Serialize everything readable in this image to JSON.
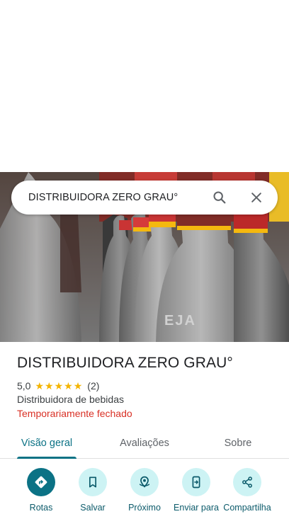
{
  "search": {
    "query": "DISTRIBUIDORA ZERO GRAU°"
  },
  "place": {
    "name": "DISTRIBUIDORA ZERO GRAU°",
    "rating": "5,0",
    "stars": 5,
    "reviews_count": "(2)",
    "category": "Distribuidora de bebidas",
    "status": "Temporariamente fechado"
  },
  "photo": {
    "label_text": "EJA"
  },
  "tabs": [
    {
      "label": "Visão geral",
      "active": true
    },
    {
      "label": "Avaliações",
      "active": false
    },
    {
      "label": "Sobre",
      "active": false
    }
  ],
  "actions": [
    {
      "label": "Rotas",
      "icon": "directions-icon",
      "primary": true
    },
    {
      "label": "Salvar",
      "icon": "bookmark-icon",
      "primary": false
    },
    {
      "label": "Próximo",
      "icon": "nearby-icon",
      "primary": false
    },
    {
      "label": "Enviar para",
      "icon": "send-to-phone-icon",
      "primary": false
    },
    {
      "label": "Compartilha",
      "icon": "share-icon",
      "primary": false
    }
  ],
  "colors": {
    "accent": "#0b7285",
    "status_closed": "#d93025",
    "star": "#f4b400",
    "action_circle": "#cdf3f4"
  }
}
